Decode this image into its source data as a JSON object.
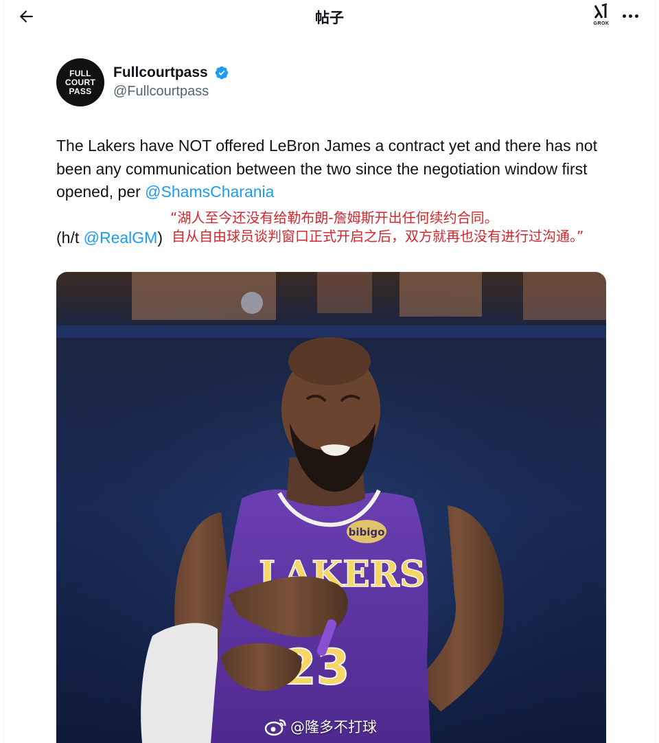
{
  "header": {
    "title": "帖子",
    "grok_label": "GROK",
    "back_icon": "arrow-left-icon",
    "more_icon": "more-horizontal-icon"
  },
  "author": {
    "avatar_lines": [
      "FULL",
      "COURT",
      "PASS"
    ],
    "display_name": "Fullcourtpass",
    "handle": "@Fullcourtpass",
    "verified": true,
    "verified_color": "#1d9bf0"
  },
  "tweet": {
    "text_main": "The Lakers have NOT offered LeBron James a contract yet and there has not been any communication between the two since the negotiation window first opened, per ",
    "mention_1": "@ShamsCharania",
    "ht_prefix": "(h/t ",
    "mention_2": "@RealGM",
    "ht_suffix": ")"
  },
  "translation": {
    "line1": "“湖人至今还没有给勒布朗-詹姆斯开出任何续约合同。",
    "line2": "自从自由球员谈判窗口正式开启之后，双方就再也没有进行过沟通。”",
    "color": "#d6262d"
  },
  "photo": {
    "jersey_text": "LAKERS",
    "jersey_number": "23",
    "patch_text": "bibigo"
  },
  "watermark": {
    "text": "@隆多不打球",
    "icon": "weibo-logo-icon"
  },
  "colors": {
    "link": "#1d9bf0",
    "text": "#0f1419",
    "secondary": "#536471"
  }
}
